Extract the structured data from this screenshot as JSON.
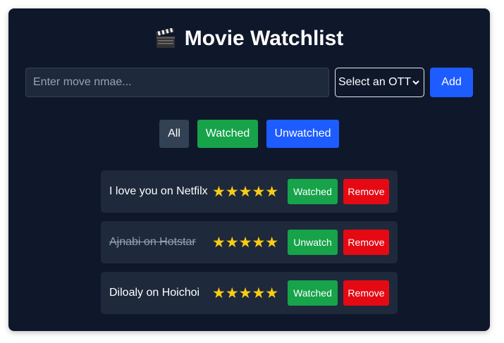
{
  "app": {
    "title": "Movie Watchlist",
    "title_icon": "clapperboard-icon"
  },
  "form": {
    "input_placeholder": "Enter move nmae...",
    "input_value": "",
    "select_value": "Select an OTT",
    "add_label": "Add"
  },
  "filters": {
    "all_label": "All",
    "watched_label": "Watched",
    "unwatched_label": "Unwatched"
  },
  "movies": [
    {
      "name": "I love you on Netfilx",
      "rating": 5,
      "stars": "★★★★★",
      "status_label": "Watched",
      "remove_label": "Remove",
      "watched": false
    },
    {
      "name": "Ajnabi on Hotstar",
      "rating": 5,
      "stars": "★★★★★",
      "status_label": "Unwatch",
      "remove_label": "Remove",
      "watched": true
    },
    {
      "name": "Diloaly on Hoichoi",
      "rating": 5,
      "stars": "★★★★★",
      "status_label": "Watched",
      "remove_label": "Remove",
      "watched": false
    }
  ],
  "colors": {
    "background": "#0f172a",
    "card": "#1e293b",
    "accent_blue": "#1d5cff",
    "accent_green": "#16a34a",
    "accent_red": "#e50914",
    "star": "#facc15"
  }
}
